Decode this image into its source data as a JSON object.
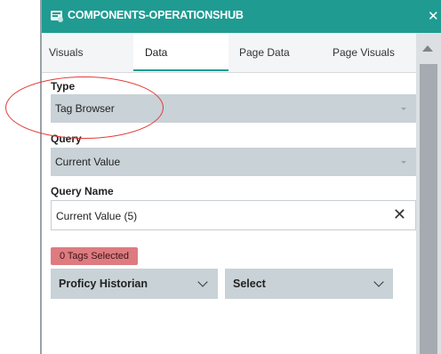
{
  "window": {
    "title": "COMPONENTS-OPERATIONSHUB",
    "logo_icon": "operations-hub-logo-icon",
    "close_icon": "close-icon"
  },
  "tabs": [
    {
      "label": "Visuals",
      "active": false
    },
    {
      "label": "Data",
      "active": true
    },
    {
      "label": "Page Data",
      "active": false
    },
    {
      "label": "Page Visuals",
      "active": false
    }
  ],
  "form": {
    "type": {
      "label": "Type",
      "value": "Tag Browser"
    },
    "query": {
      "label": "Query",
      "value": "Current Value"
    },
    "query_name": {
      "label": "Query Name",
      "value": "Current Value (5)"
    },
    "tags_badge": "0 Tags Selected",
    "source_dropdown": {
      "value": "Proficy Historian"
    },
    "select_dropdown": {
      "value": "Select"
    }
  },
  "colors": {
    "accent": "#1f9b92",
    "select_bg": "#c9d2d7",
    "badge_bg": "#de7b80",
    "annotation": "#e53935"
  }
}
